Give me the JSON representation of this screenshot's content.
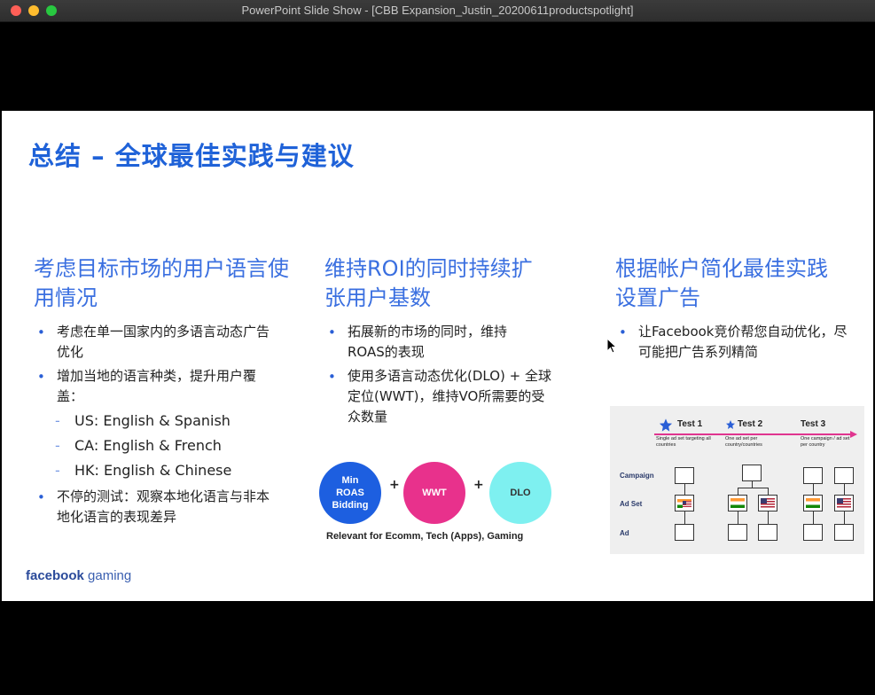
{
  "window": {
    "title": "PowerPoint Slide Show - [CBB Expansion_Justin_20200611productspotlight]"
  },
  "slide": {
    "title": "总结 – 全球最佳实践与建议",
    "columns": [
      {
        "heading": "考虑目标市场的用户语言使用情况",
        "bullets": [
          {
            "text": "考虑在单一国家内的多语言动态广告优化"
          },
          {
            "text": "增加当地的语言种类，提升用户覆盖：",
            "sub": [
              "US: English & Spanish",
              "CA: English & French",
              "HK: English & Chinese"
            ]
          },
          {
            "text": "不停的测试：观察本地化语言与非本地化语言的表现差异"
          }
        ]
      },
      {
        "heading": "维持ROI的同时持续扩张用户基数",
        "bullets": [
          {
            "text": "拓展新的市场的同时，维持ROAS的表现"
          },
          {
            "text": "使用多语言动态优化(DLO) + 全球定位(WWT)，维持VO所需要的受众数量"
          }
        ]
      },
      {
        "heading": "根据帐户简化最佳实践设置广告",
        "bullets": [
          {
            "text": "让Facebook竞价帮您自动优化，尽可能把广告系列精简"
          }
        ]
      }
    ],
    "circles": [
      {
        "label": "Min ROAS Bidding",
        "color": "#1d5fe0"
      },
      {
        "label": "WWT",
        "color": "#e8318c"
      },
      {
        "label": "DLO",
        "color": "#7ef0f0"
      }
    ],
    "plus": "+",
    "relevant_text": "Relevant for Ecomm, Tech (Apps), Gaming",
    "logo": {
      "brand": "facebook",
      "suffix": "gaming"
    },
    "diagram": {
      "tests": [
        {
          "title": "Test 1",
          "desc": "Single ad set targeting all countries"
        },
        {
          "title": "Test 2",
          "desc": "One ad set per country/countries"
        },
        {
          "title": "Test 3",
          "desc": "One campaign / ad set per country"
        }
      ],
      "row_labels": [
        "Campaign",
        "Ad Set",
        "Ad"
      ]
    }
  }
}
